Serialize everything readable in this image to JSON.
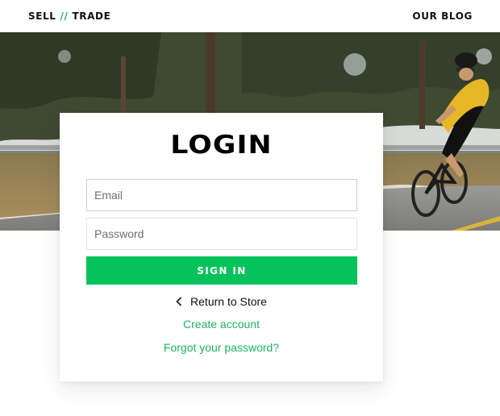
{
  "header": {
    "brand_left": "SELL",
    "brand_sep": "//",
    "brand_right": "TRADE",
    "nav_blog": "OUR BLOG"
  },
  "hero": {
    "image_description": "cyclist-on-road-photo"
  },
  "login": {
    "title": "LOGIN",
    "email_placeholder": "Email",
    "password_placeholder": "Password",
    "signin_label": "SIGN IN",
    "return_label": "Return to Store",
    "create_account_label": "Create account",
    "forgot_password_label": "Forgot your password?"
  },
  "colors": {
    "accent_green": "#06c25b",
    "link_green": "#1fb35d",
    "text_dark": "#111111"
  },
  "icons": {
    "return": "chevron-left-icon"
  }
}
